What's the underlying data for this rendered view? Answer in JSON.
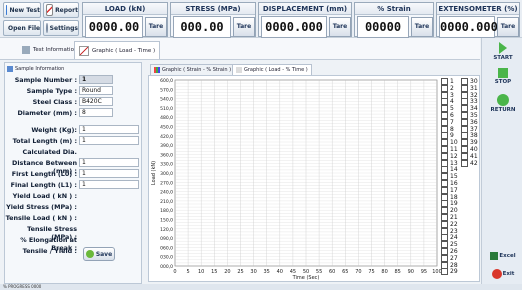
{
  "toolbar": {
    "buttons": [
      {
        "label": "New Test",
        "icon": "new-test-icon"
      },
      {
        "label": "Report",
        "icon": "report-icon"
      },
      {
        "label": "Open File",
        "icon": "folder-icon"
      },
      {
        "label": "Settings",
        "icon": "settings-icon"
      }
    ]
  },
  "meters": [
    {
      "title": "LOAD (kN)",
      "value": "0000.00",
      "tare": "Tare"
    },
    {
      "title": "STRESS (MPa)",
      "value": "000.00",
      "tare": "Tare"
    },
    {
      "title": "DISPLACEMENT (mm)",
      "value": "0000.000",
      "tare": "Tare"
    },
    {
      "title": "% Strain",
      "value": "00000",
      "tare": "Tare"
    },
    {
      "title": "EXTENSOMETER (%)",
      "value": "0000.000",
      "tare": "Tare"
    }
  ],
  "tabs": {
    "test_information": "Test Information",
    "graphic": "Graphic ( Load - Time )"
  },
  "sample": {
    "tab_label": "Sample Information",
    "fields": [
      {
        "label": "Sample Number :",
        "value": "1"
      },
      {
        "label": "Sample Type :",
        "value": "Round"
      },
      {
        "label": "Steel Class :",
        "value": "B420C"
      },
      {
        "label": "Diameter (mm) :",
        "value": "8"
      },
      {
        "label": "Weight (Kg):",
        "value": "1"
      },
      {
        "label": "Total Length (m) :",
        "value": "1"
      },
      {
        "label": "Calculated Dia.",
        "value": ""
      },
      {
        "label": "Distance Between (mm) :",
        "value": "1"
      },
      {
        "label": "First Length (L0) :",
        "value": "1"
      },
      {
        "label": "Final Length (L1) :",
        "value": "1"
      },
      {
        "label": "Yield Load ( kN ) :",
        "value": ""
      },
      {
        "label": "Yield Stress (MPa) :",
        "value": ""
      },
      {
        "label": "Tensile Load ( kN ) :",
        "value": ""
      },
      {
        "label": "Tensile Stress (MPa) :",
        "value": ""
      },
      {
        "label": "% Elongation at Break :",
        "value": ""
      },
      {
        "label": "Tensile / Yield :",
        "value": ""
      }
    ],
    "save_label": "Save"
  },
  "graph_tabs": [
    "Graphic ( Strain - % Strain )",
    "Graphic ( Load - % Time )"
  ],
  "side_buttons": {
    "start": "START",
    "stop": "STOP",
    "return": "RETURN",
    "excel": "Excel",
    "exit": "Exit"
  },
  "status": "% PROGRESS 0000",
  "chart_data": {
    "type": "line",
    "title": "",
    "xlabel": "Time (Sec)",
    "ylabel": "Load (kN)",
    "x_ticks": [
      "0",
      "5",
      "10",
      "15",
      "20",
      "25",
      "30",
      "35",
      "40",
      "45",
      "50",
      "55",
      "60",
      "65",
      "70",
      "75",
      "80",
      "85",
      "90",
      "95",
      "100"
    ],
    "y_ticks": [
      "600,0",
      "570,0",
      "540,0",
      "510,0",
      "480,0",
      "450,0",
      "420,0",
      "390,0",
      "360,0",
      "330,0",
      "300,0",
      "270,0",
      "240,0",
      "210,0",
      "180,0",
      "150,0",
      "120,0",
      "090,0",
      "060,0",
      "030,0",
      "000,0"
    ],
    "xlim": [
      0,
      100
    ],
    "ylim": [
      0,
      600
    ],
    "grid": true,
    "series": [],
    "legend_checkboxes": [
      "1",
      "2",
      "3",
      "4",
      "5",
      "6",
      "7",
      "8",
      "9",
      "10",
      "11",
      "12",
      "13",
      "14",
      "15",
      "16",
      "17",
      "18",
      "19",
      "20",
      "21",
      "22",
      "23",
      "24",
      "25",
      "26",
      "27",
      "28",
      "29",
      "30",
      "31",
      "32",
      "33",
      "34",
      "35",
      "36",
      "37",
      "38",
      "39",
      "40",
      "41",
      "42"
    ]
  }
}
